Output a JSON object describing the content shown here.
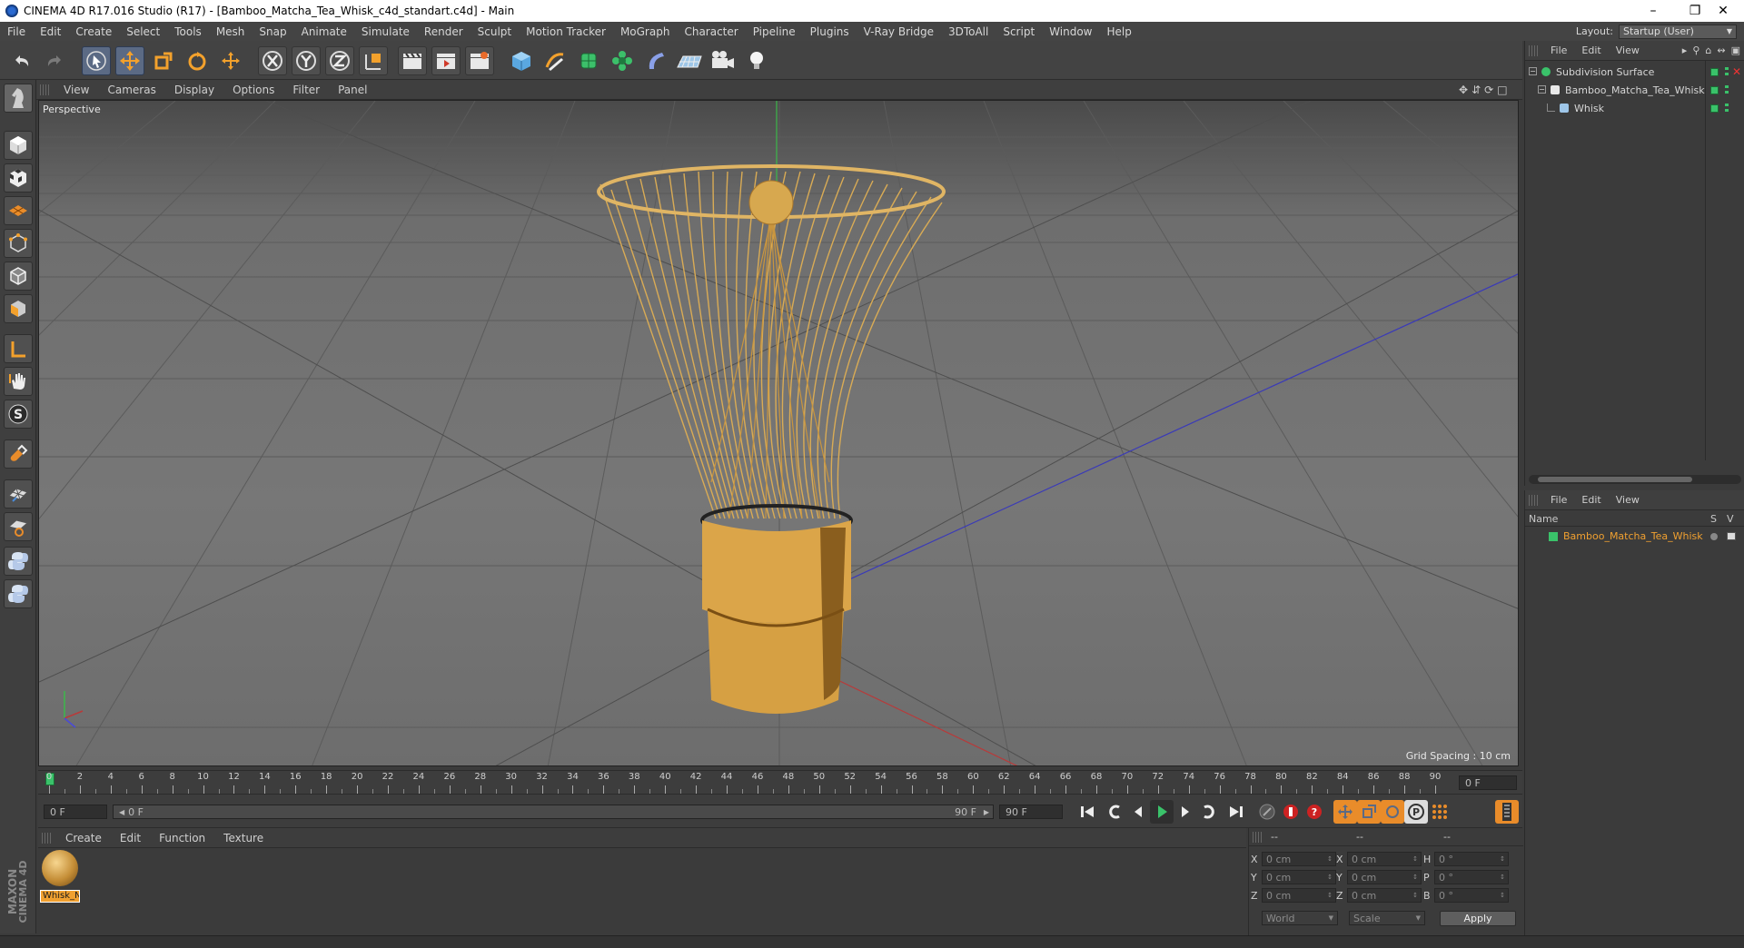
{
  "app": {
    "title": "CINEMA 4D R17.016 Studio (R17) - [Bamboo_Matcha_Tea_Whisk_c4d_standart.c4d] - Main"
  },
  "menubar": {
    "items": [
      "File",
      "Edit",
      "Create",
      "Select",
      "Tools",
      "Mesh",
      "Snap",
      "Animate",
      "Simulate",
      "Render",
      "Sculpt",
      "Motion Tracker",
      "MoGraph",
      "Character",
      "Pipeline",
      "Plugins",
      "V-Ray Bridge",
      "3DToAll",
      "Script",
      "Window",
      "Help"
    ],
    "layout_label": "Layout:",
    "layout_value": "Startup (User)"
  },
  "viewport": {
    "menu": [
      "View",
      "Cameras",
      "Display",
      "Options",
      "Filter",
      "Panel"
    ],
    "label": "Perspective",
    "grid_spacing": "Grid Spacing : 10 cm"
  },
  "timeline": {
    "ticks": [
      "0",
      "2",
      "4",
      "6",
      "8",
      "10",
      "12",
      "14",
      "16",
      "18",
      "20",
      "22",
      "24",
      "26",
      "28",
      "30",
      "32",
      "34",
      "36",
      "38",
      "40",
      "42",
      "44",
      "46",
      "48",
      "50",
      "52",
      "54",
      "56",
      "58",
      "60",
      "62",
      "64",
      "66",
      "68",
      "70",
      "72",
      "74",
      "76",
      "78",
      "80",
      "82",
      "84",
      "86",
      "88",
      "90"
    ],
    "current_frame": "0 F",
    "start_frame": "0 F",
    "range_start": "0 F",
    "range_end": "90 F",
    "end_frame": "90 F"
  },
  "material_manager": {
    "menu": [
      "Create",
      "Edit",
      "Function",
      "Texture"
    ],
    "material_name": "Whisk_N"
  },
  "brand": {
    "line1": "MAXON",
    "line2": "CINEMA 4D"
  },
  "coordinates": {
    "header": [
      "--",
      "--",
      "--"
    ],
    "rows": [
      {
        "l1": "X",
        "v1": "0 cm",
        "l2": "X",
        "v2": "0 cm",
        "l3": "H",
        "v3": "0 °"
      },
      {
        "l1": "Y",
        "v1": "0 cm",
        "l2": "Y",
        "v2": "0 cm",
        "l3": "P",
        "v3": "0 °"
      },
      {
        "l1": "Z",
        "v1": "0 cm",
        "l2": "Z",
        "v2": "0 cm",
        "l3": "B",
        "v3": "0 °"
      }
    ],
    "mode1": "World",
    "mode2": "Scale",
    "apply": "Apply"
  },
  "object_manager": {
    "menu": [
      "File",
      "Edit",
      "View"
    ],
    "objects": [
      {
        "name": "Subdivision Surface",
        "indent": 0
      },
      {
        "name": "Bamboo_Matcha_Tea_Whisk",
        "indent": 1
      },
      {
        "name": "Whisk",
        "indent": 2
      }
    ]
  },
  "attribute_manager": {
    "menu": [
      "File",
      "Edit",
      "View"
    ],
    "col_name": "Name",
    "col_s": "S",
    "col_v": "V",
    "rows": [
      {
        "name": "Bamboo_Matcha_Tea_Whisk",
        "color": "#f0a030"
      }
    ]
  },
  "colors": {
    "accent_orange": "#f0a030",
    "active_blue": "#5b6a84",
    "object_green": "#3ac26a"
  }
}
